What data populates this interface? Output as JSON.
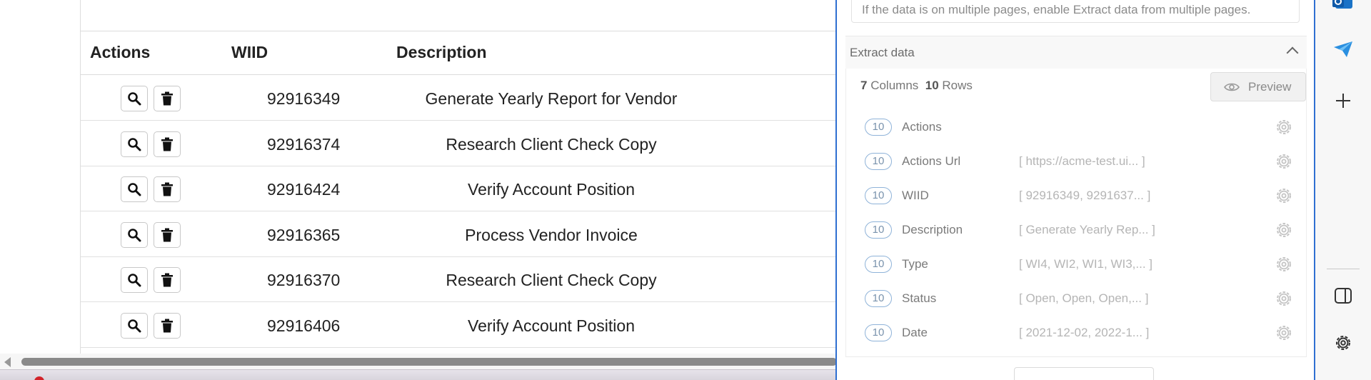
{
  "table": {
    "headers": {
      "actions": "Actions",
      "wiid": "WIID",
      "description": "Description"
    },
    "rows": [
      {
        "wiid": "92916349",
        "description": "Generate Yearly Report for Vendor"
      },
      {
        "wiid": "92916374",
        "description": "Research Client Check Copy"
      },
      {
        "wiid": "92916424",
        "description": "Verify Account Position"
      },
      {
        "wiid": "92916365",
        "description": "Process Vendor Invoice"
      },
      {
        "wiid": "92916370",
        "description": "Research Client Check Copy"
      },
      {
        "wiid": "92916406",
        "description": "Verify Account Position"
      }
    ],
    "row_actions": {
      "view": "search-icon",
      "delete": "trash-icon"
    }
  },
  "panel": {
    "hint": "If the data is on multiple pages, enable Extract data from multiple pages.",
    "section_title": "Extract data",
    "summary": {
      "columns_count": "7",
      "columns_label": "Columns",
      "rows_count": "10",
      "rows_label": "Rows"
    },
    "preview_label": "Preview",
    "columns": [
      {
        "count": "10",
        "name": "Actions",
        "sample": ""
      },
      {
        "count": "10",
        "name": "Actions Url",
        "sample": "[ https://acme-test.ui... ]"
      },
      {
        "count": "10",
        "name": "WIID",
        "sample": "[ 92916349, 9291637... ]"
      },
      {
        "count": "10",
        "name": "Description",
        "sample": "[ Generate Yearly Rep... ]"
      },
      {
        "count": "10",
        "name": "Type",
        "sample": "[ WI4, WI2, WI1, WI3,... ]"
      },
      {
        "count": "10",
        "name": "Status",
        "sample": "[ Open, Open, Open,... ]"
      },
      {
        "count": "10",
        "name": "Date",
        "sample": "[ 2021-12-02, 2022-1... ]"
      }
    ]
  },
  "sidebar_icons": [
    "outlook-icon",
    "send-icon",
    "add-icon",
    "split-screen-icon",
    "settings-icon"
  ],
  "colors": {
    "panel_border": "#2f6fd1",
    "badge_border": "#8fb3d9",
    "scroll_thumb": "#8a8a8a"
  }
}
